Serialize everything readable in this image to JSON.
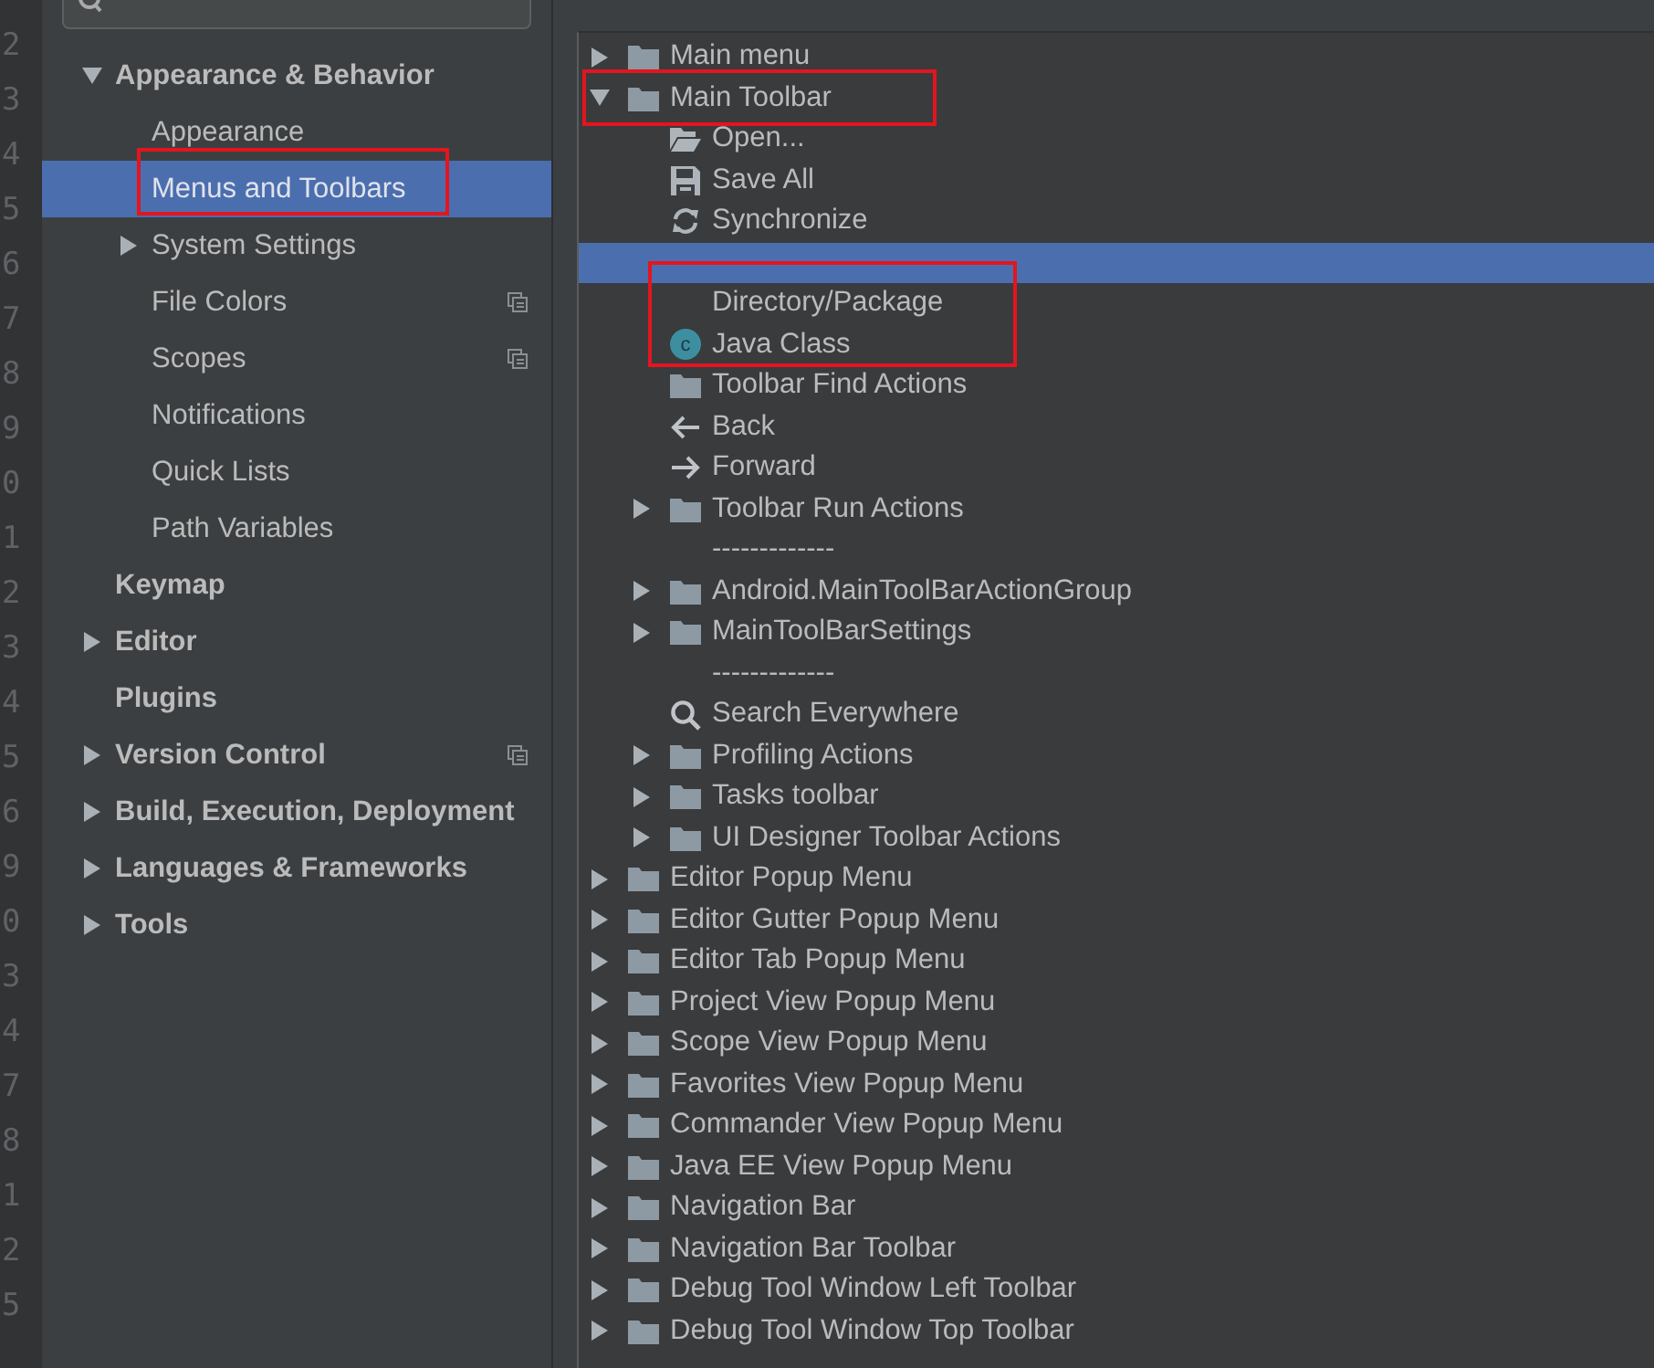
{
  "gutter": {
    "line_numbers": [
      "2",
      "3",
      "4",
      "5",
      "6",
      "7",
      "8",
      "9",
      "0",
      "1",
      "2",
      "3",
      "4",
      "5",
      "6",
      "9",
      "0",
      "3",
      "4",
      "7",
      "8",
      "1",
      "2",
      "5"
    ]
  },
  "sidebar": {
    "items": [
      {
        "label": "Appearance & Behavior",
        "expanded": true,
        "selected": false,
        "annotated": false,
        "children": [
          {
            "label": "Appearance",
            "selected": false,
            "annotated": false
          },
          {
            "label": "Menus and Toolbars",
            "selected": true,
            "annotated": true
          },
          {
            "label": "System Settings",
            "expanded": false,
            "selected": false,
            "annotated": false
          },
          {
            "label": "File Colors",
            "selected": false,
            "annotated": false,
            "project_level": true
          },
          {
            "label": "Scopes",
            "selected": false,
            "annotated": false,
            "project_level": true
          },
          {
            "label": "Notifications",
            "selected": false,
            "annotated": false
          },
          {
            "label": "Quick Lists",
            "selected": false,
            "annotated": false
          },
          {
            "label": "Path Variables",
            "selected": false,
            "annotated": false
          }
        ]
      },
      {
        "label": "Keymap",
        "selected": false,
        "annotated": false
      },
      {
        "label": "Editor",
        "expanded": false,
        "selected": false,
        "annotated": false
      },
      {
        "label": "Plugins",
        "selected": false,
        "annotated": false
      },
      {
        "label": "Version Control",
        "expanded": false,
        "selected": false,
        "annotated": false,
        "project_level": true
      },
      {
        "label": "Build, Execution, Deployment",
        "expanded": false,
        "selected": false,
        "annotated": false
      },
      {
        "label": "Languages & Frameworks",
        "expanded": false,
        "selected": false,
        "annotated": false
      },
      {
        "label": "Tools",
        "expanded": false,
        "selected": false,
        "annotated": false
      }
    ]
  },
  "tree": {
    "items": [
      {
        "kind": "group",
        "label": "Main menu",
        "expanded": false,
        "selected": false,
        "annotated": false
      },
      {
        "kind": "group",
        "label": "Main Toolbar",
        "expanded": true,
        "selected": false,
        "annotated": true,
        "children": [
          {
            "kind": "open",
            "label": "Open...",
            "selected": false,
            "annotated": false
          },
          {
            "kind": "save",
            "label": "Save All",
            "selected": false,
            "annotated": false
          },
          {
            "kind": "sync",
            "label": "Synchronize",
            "selected": false,
            "annotated": false
          },
          {
            "kind": "blank",
            "selected": true,
            "annotated": false
          },
          {
            "kind": "plain",
            "label": "Directory/Package",
            "selected": false,
            "annotated": true
          },
          {
            "kind": "class",
            "label": "Java Class",
            "icon_letter": "c",
            "selected": false,
            "annotated": true
          },
          {
            "kind": "folder",
            "label": "Toolbar Find Actions",
            "selected": false,
            "annotated": false
          },
          {
            "kind": "back",
            "label": "Back",
            "selected": false,
            "annotated": false
          },
          {
            "kind": "forward",
            "label": "Forward",
            "selected": false,
            "annotated": false
          },
          {
            "kind": "group",
            "label": "Toolbar Run Actions",
            "expanded": false,
            "selected": false,
            "annotated": false
          },
          {
            "kind": "separator",
            "label": "-------------",
            "selected": false,
            "annotated": false
          },
          {
            "kind": "group",
            "label": "Android.MainToolBarActionGroup",
            "expanded": false,
            "selected": false,
            "annotated": false
          },
          {
            "kind": "group",
            "label": "MainToolBarSettings",
            "expanded": false,
            "selected": false,
            "annotated": false
          },
          {
            "kind": "separator",
            "label": "-------------",
            "selected": false,
            "annotated": false
          },
          {
            "kind": "search",
            "label": "Search Everywhere",
            "selected": false,
            "annotated": false
          },
          {
            "kind": "group",
            "label": "Profiling Actions",
            "expanded": false,
            "selected": false,
            "annotated": false
          },
          {
            "kind": "group",
            "label": "Tasks toolbar",
            "expanded": false,
            "selected": false,
            "annotated": false
          },
          {
            "kind": "group",
            "label": "UI Designer Toolbar Actions",
            "expanded": false,
            "selected": false,
            "annotated": false
          }
        ]
      },
      {
        "kind": "group",
        "label": "Editor Popup Menu",
        "expanded": false,
        "selected": false,
        "annotated": false
      },
      {
        "kind": "group",
        "label": "Editor Gutter Popup Menu",
        "expanded": false,
        "selected": false,
        "annotated": false
      },
      {
        "kind": "group",
        "label": "Editor Tab Popup Menu",
        "expanded": false,
        "selected": false,
        "annotated": false
      },
      {
        "kind": "group",
        "label": "Project View Popup Menu",
        "expanded": false,
        "selected": false,
        "annotated": false
      },
      {
        "kind": "group",
        "label": "Scope View Popup Menu",
        "expanded": false,
        "selected": false,
        "annotated": false
      },
      {
        "kind": "group",
        "label": "Favorites View Popup Menu",
        "expanded": false,
        "selected": false,
        "annotated": false
      },
      {
        "kind": "group",
        "label": "Commander View Popup Menu",
        "expanded": false,
        "selected": false,
        "annotated": false
      },
      {
        "kind": "group",
        "label": "Java EE View Popup Menu",
        "expanded": false,
        "selected": false,
        "annotated": false
      },
      {
        "kind": "group",
        "label": "Navigation Bar",
        "expanded": false,
        "selected": false,
        "annotated": false
      },
      {
        "kind": "group",
        "label": "Navigation Bar Toolbar",
        "expanded": false,
        "selected": false,
        "annotated": false
      },
      {
        "kind": "group",
        "label": "Debug Tool Window Left Toolbar",
        "expanded": false,
        "selected": false,
        "annotated": false
      },
      {
        "kind": "group",
        "label": "Debug Tool Window Top Toolbar",
        "expanded": false,
        "selected": false,
        "annotated": false
      }
    ]
  }
}
